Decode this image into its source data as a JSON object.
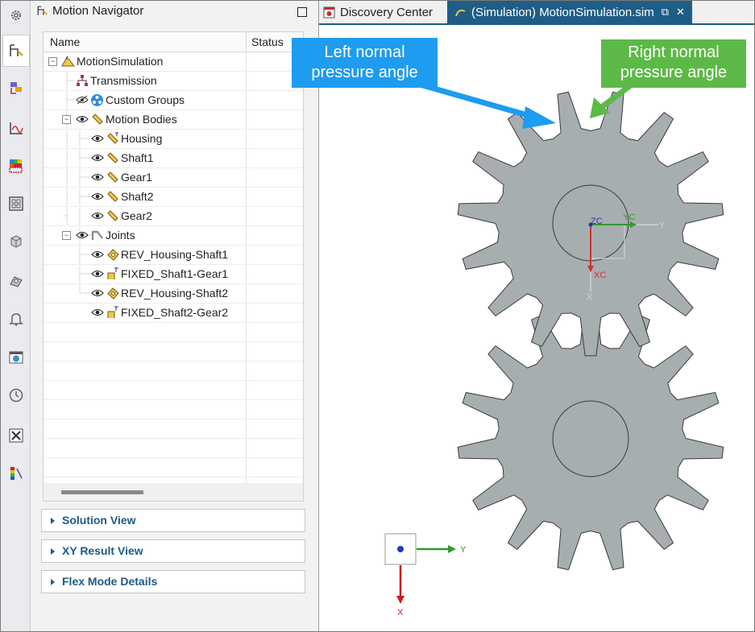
{
  "navigator": {
    "title": "Motion Navigator",
    "columns": {
      "name": "Name",
      "status": "Status"
    },
    "tree": [
      {
        "label": "MotionSimulation"
      },
      {
        "label": "Transmission"
      },
      {
        "label": "Custom Groups"
      },
      {
        "label": "Motion Bodies"
      },
      {
        "label": "Housing"
      },
      {
        "label": "Shaft1"
      },
      {
        "label": "Gear1"
      },
      {
        "label": "Shaft2"
      },
      {
        "label": "Gear2"
      },
      {
        "label": "Joints"
      },
      {
        "label": "REV_Housing-Shaft1"
      },
      {
        "label": "FIXED_Shaft1-Gear1"
      },
      {
        "label": "REV_Housing-Shaft2"
      },
      {
        "label": "FIXED_Shaft2-Gear2"
      }
    ],
    "sections": [
      {
        "label": "Solution View"
      },
      {
        "label": "XY Result View"
      },
      {
        "label": "Flex Mode Details"
      }
    ]
  },
  "tabs": [
    {
      "label": "Discovery Center"
    },
    {
      "label": "(Simulation) MotionSimulation.sim"
    }
  ],
  "tab_controls": {
    "undock": "⧉",
    "close": "✕"
  },
  "callouts": {
    "left": [
      "Left normal",
      "pressure angle"
    ],
    "right": [
      "Right normal",
      "pressure angle"
    ]
  },
  "axes": {
    "wcs": {
      "zc": "ZC",
      "yc": "YC",
      "xc": "XC",
      "y": "Y",
      "x": "X"
    },
    "triad": {
      "y": "Y",
      "x": "X"
    }
  },
  "colors": {
    "accent": "#1e5e85",
    "callout_left": "#1e9cf0",
    "callout_right": "#5cb947",
    "gear_fill": "#a7aeb0",
    "x_axis": "#c81e1e",
    "y_axis": "#2f9a2f",
    "z_axis": "#2030c0"
  },
  "toolbar_icons": [
    "settings-icon",
    "motion-navigator-icon",
    "assembly-navigator-icon",
    "graph-icon",
    "color-palette-icon",
    "layout-grid-icon",
    "part-icon",
    "hand-tool-icon",
    "bell-icon",
    "web-browser-icon",
    "clock-icon",
    "tools-icon",
    "color-legend-icon"
  ]
}
